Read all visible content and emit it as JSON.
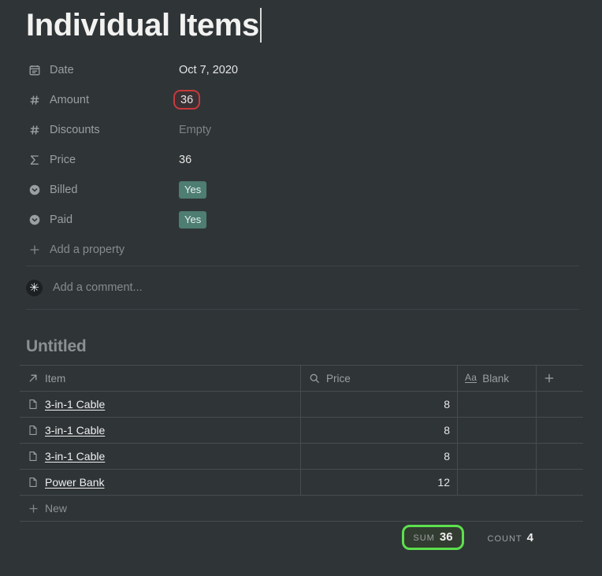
{
  "page": {
    "title": "Individual Items",
    "has_caret": true
  },
  "properties": [
    {
      "icon": "calendar-icon",
      "label": "Date",
      "value": "Oct 7, 2020",
      "kind": "text"
    },
    {
      "icon": "hash-icon",
      "label": "Amount",
      "value": "36",
      "kind": "highlighted-number"
    },
    {
      "icon": "hash-icon",
      "label": "Discounts",
      "value": "Empty",
      "kind": "empty"
    },
    {
      "icon": "sigma-icon",
      "label": "Price",
      "value": "36",
      "kind": "text"
    },
    {
      "icon": "select-icon",
      "label": "Billed",
      "value": "Yes",
      "kind": "badge"
    },
    {
      "icon": "select-icon",
      "label": "Paid",
      "value": "Yes",
      "kind": "badge"
    }
  ],
  "add_property": {
    "label": "Add a property"
  },
  "comment": {
    "placeholder": "Add a comment...",
    "avatar_glyph": "✳"
  },
  "database": {
    "title": "Untitled",
    "columns": [
      {
        "icon": "relation-arrow-icon",
        "label": "Item"
      },
      {
        "icon": "rollup-search-icon",
        "label": "Price"
      },
      {
        "icon": "text-aa-icon",
        "label": "Blank"
      }
    ],
    "add_column_label": "+",
    "rows": [
      {
        "item": "3-in-1 Cable",
        "price": "8",
        "blank": ""
      },
      {
        "item": "3-in-1 Cable",
        "price": "8",
        "blank": ""
      },
      {
        "item": "3-in-1 Cable",
        "price": "8",
        "blank": ""
      },
      {
        "item": "Power Bank",
        "price": "12",
        "blank": ""
      }
    ],
    "new_row_label": "New",
    "aggregations": [
      {
        "key": "SUM",
        "value": "36",
        "highlighted": true
      },
      {
        "key": "COUNT",
        "value": "4",
        "highlighted": false
      }
    ]
  },
  "colors": {
    "background": "#2f3437",
    "highlight_red": "#c9393a",
    "highlight_green": "#5ce04d",
    "badge_teal": "#4e7d72",
    "border": "#474c50"
  }
}
